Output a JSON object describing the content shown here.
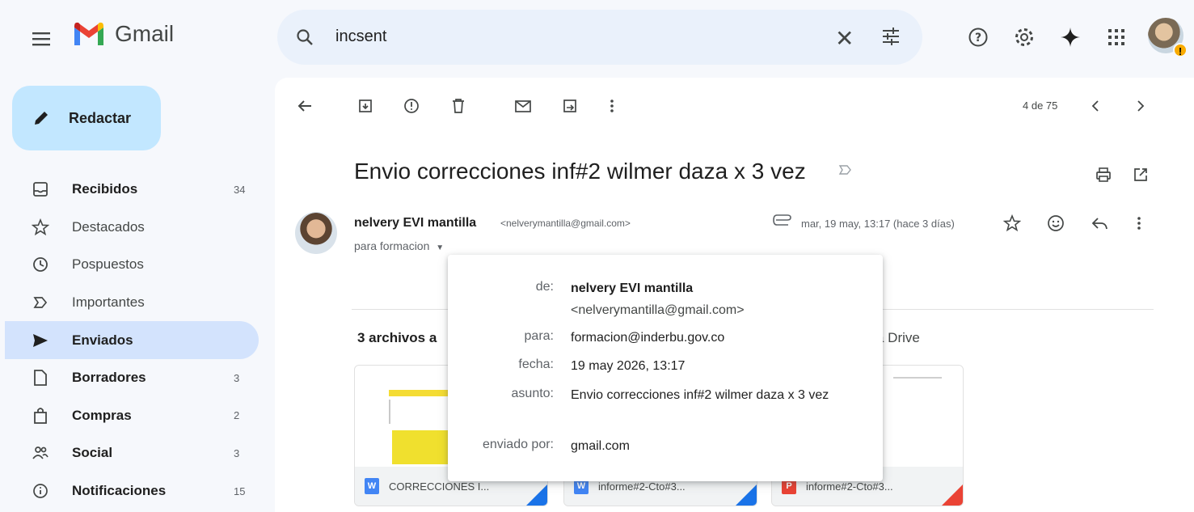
{
  "app": {
    "name": "Gmail"
  },
  "search": {
    "query": "incsent"
  },
  "compose": {
    "label": "Redactar"
  },
  "nav": [
    {
      "label": "Recibidos",
      "count": "34",
      "bold": true,
      "icon": "inbox-icon"
    },
    {
      "label": "Destacados",
      "count": "",
      "bold": false,
      "icon": "star-icon"
    },
    {
      "label": "Pospuestos",
      "count": "",
      "bold": false,
      "icon": "clock-icon"
    },
    {
      "label": "Importantes",
      "count": "",
      "bold": false,
      "icon": "important-icon"
    },
    {
      "label": "Enviados",
      "count": "",
      "bold": true,
      "active": true,
      "icon": "send-icon"
    },
    {
      "label": "Borradores",
      "count": "3",
      "bold": true,
      "icon": "draft-icon"
    },
    {
      "label": "Compras",
      "count": "2",
      "bold": true,
      "icon": "shopping-icon"
    },
    {
      "label": "Social",
      "count": "3",
      "bold": true,
      "icon": "people-icon"
    },
    {
      "label": "Notificaciones",
      "count": "15",
      "bold": true,
      "icon": "info-icon"
    }
  ],
  "pager": {
    "text": "4 de 75"
  },
  "message": {
    "subject": "Envio correcciones inf#2 wilmer daza x 3 vez",
    "sender_name": "nelvery EVI mantilla",
    "sender_email": "<nelverymantilla@gmail.com>",
    "to_line": "para formacion",
    "date": "mar, 19 may, 13:17 (hace 3 días)"
  },
  "attachments": {
    "title": "3 archivos a",
    "drive_text": "a Drive",
    "files": [
      {
        "name": "CORRECCIONES I...",
        "icon_color": "#4285f4",
        "icon_letter": "W"
      },
      {
        "name": "informe#2-Cto#3...",
        "icon_color": "#4285f4",
        "icon_letter": "W"
      },
      {
        "name": "informe#2-Cto#3...",
        "icon_color": "#ea4335",
        "icon_letter": "P"
      }
    ]
  },
  "details": {
    "de_label": "de:",
    "de_name": "nelvery EVI mantilla",
    "de_email": "<nelverymantilla@gmail.com>",
    "para_label": "para:",
    "para_value": "formacion@inderbu.gov.co",
    "fecha_label": "fecha:",
    "fecha_value": "19 may 2026, 13:17",
    "asunto_label": "asunto:",
    "asunto_value": "Envio correcciones inf#2 wilmer daza x 3 vez",
    "enviado_label": "enviado por:",
    "enviado_value": "gmail.com"
  },
  "colors": {
    "accent_compose": "#c2e7ff",
    "active_nav": "#d3e3fd",
    "search_bg": "#eaf1fb"
  }
}
